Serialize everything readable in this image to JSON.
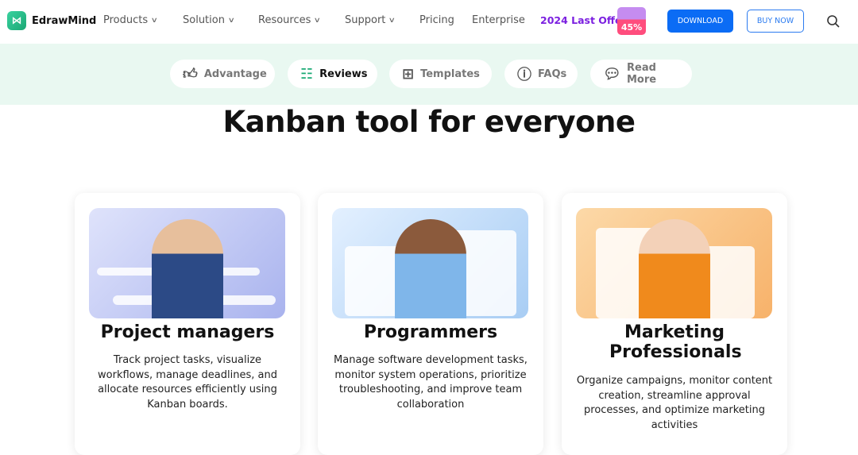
{
  "nav": {
    "brand": "EdrawMind",
    "logo_icon": "edrawmind-logo",
    "menus": [
      "Products",
      "Solution",
      "Resources",
      "Support",
      "Pricing",
      "Enterprise"
    ],
    "offer": "2024 Last Offer",
    "offer_badge": "45%",
    "download": "DOWNLOAD",
    "buy_now": "BUY NOW",
    "search_icon": "search-icon"
  },
  "tabs": [
    {
      "label": "Advantage",
      "icon": "thumbs-up-icon"
    },
    {
      "label": "Reviews",
      "icon": "clipboard-icon",
      "active": true
    },
    {
      "label": "Templates",
      "icon": "grid-icon"
    },
    {
      "label": "FAQs",
      "icon": "question-icon"
    },
    {
      "label": "Read More",
      "icon": "chat-icon"
    }
  ],
  "title": "Kanban tool for everyone",
  "cards": [
    {
      "title": "Project managers",
      "desc": "Track project tasks, visualize workflows, manage deadlines, and allocate resources efficiently using Kanban boards."
    },
    {
      "title": "Programmers",
      "desc": "Manage software development tasks, monitor system operations, prioritize troubleshooting, and improve team collaboration"
    },
    {
      "title": "Marketing Professionals",
      "desc": "Organize campaigns, monitor content creation, streamline approval processes, and optimize marketing activities"
    }
  ],
  "colors": {
    "accent": "#0b6cf5",
    "offer": "#7b1fe0",
    "band": "#e9f8f1",
    "active_icon": "#19a974"
  }
}
